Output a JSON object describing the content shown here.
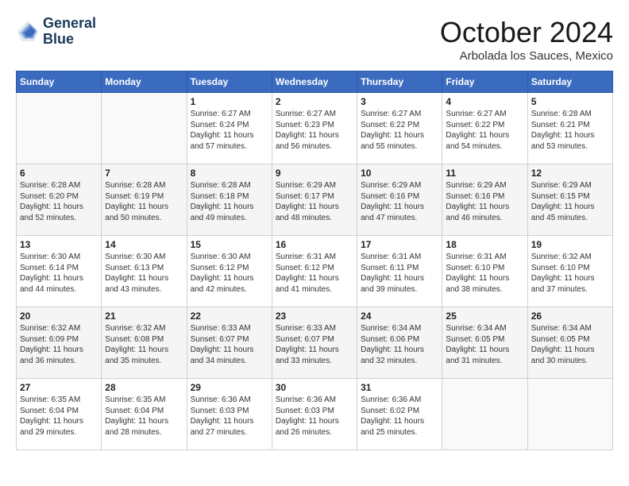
{
  "header": {
    "logo_line1": "General",
    "logo_line2": "Blue",
    "month_title": "October 2024",
    "location": "Arbolada los Sauces, Mexico"
  },
  "days_of_week": [
    "Sunday",
    "Monday",
    "Tuesday",
    "Wednesday",
    "Thursday",
    "Friday",
    "Saturday"
  ],
  "weeks": [
    [
      {
        "day": "",
        "sunrise": "",
        "sunset": "",
        "daylight": ""
      },
      {
        "day": "",
        "sunrise": "",
        "sunset": "",
        "daylight": ""
      },
      {
        "day": "1",
        "sunrise": "Sunrise: 6:27 AM",
        "sunset": "Sunset: 6:24 PM",
        "daylight": "Daylight: 11 hours and 57 minutes."
      },
      {
        "day": "2",
        "sunrise": "Sunrise: 6:27 AM",
        "sunset": "Sunset: 6:23 PM",
        "daylight": "Daylight: 11 hours and 56 minutes."
      },
      {
        "day": "3",
        "sunrise": "Sunrise: 6:27 AM",
        "sunset": "Sunset: 6:22 PM",
        "daylight": "Daylight: 11 hours and 55 minutes."
      },
      {
        "day": "4",
        "sunrise": "Sunrise: 6:27 AM",
        "sunset": "Sunset: 6:22 PM",
        "daylight": "Daylight: 11 hours and 54 minutes."
      },
      {
        "day": "5",
        "sunrise": "Sunrise: 6:28 AM",
        "sunset": "Sunset: 6:21 PM",
        "daylight": "Daylight: 11 hours and 53 minutes."
      }
    ],
    [
      {
        "day": "6",
        "sunrise": "Sunrise: 6:28 AM",
        "sunset": "Sunset: 6:20 PM",
        "daylight": "Daylight: 11 hours and 52 minutes."
      },
      {
        "day": "7",
        "sunrise": "Sunrise: 6:28 AM",
        "sunset": "Sunset: 6:19 PM",
        "daylight": "Daylight: 11 hours and 50 minutes."
      },
      {
        "day": "8",
        "sunrise": "Sunrise: 6:28 AM",
        "sunset": "Sunset: 6:18 PM",
        "daylight": "Daylight: 11 hours and 49 minutes."
      },
      {
        "day": "9",
        "sunrise": "Sunrise: 6:29 AM",
        "sunset": "Sunset: 6:17 PM",
        "daylight": "Daylight: 11 hours and 48 minutes."
      },
      {
        "day": "10",
        "sunrise": "Sunrise: 6:29 AM",
        "sunset": "Sunset: 6:16 PM",
        "daylight": "Daylight: 11 hours and 47 minutes."
      },
      {
        "day": "11",
        "sunrise": "Sunrise: 6:29 AM",
        "sunset": "Sunset: 6:16 PM",
        "daylight": "Daylight: 11 hours and 46 minutes."
      },
      {
        "day": "12",
        "sunrise": "Sunrise: 6:29 AM",
        "sunset": "Sunset: 6:15 PM",
        "daylight": "Daylight: 11 hours and 45 minutes."
      }
    ],
    [
      {
        "day": "13",
        "sunrise": "Sunrise: 6:30 AM",
        "sunset": "Sunset: 6:14 PM",
        "daylight": "Daylight: 11 hours and 44 minutes."
      },
      {
        "day": "14",
        "sunrise": "Sunrise: 6:30 AM",
        "sunset": "Sunset: 6:13 PM",
        "daylight": "Daylight: 11 hours and 43 minutes."
      },
      {
        "day": "15",
        "sunrise": "Sunrise: 6:30 AM",
        "sunset": "Sunset: 6:12 PM",
        "daylight": "Daylight: 11 hours and 42 minutes."
      },
      {
        "day": "16",
        "sunrise": "Sunrise: 6:31 AM",
        "sunset": "Sunset: 6:12 PM",
        "daylight": "Daylight: 11 hours and 41 minutes."
      },
      {
        "day": "17",
        "sunrise": "Sunrise: 6:31 AM",
        "sunset": "Sunset: 6:11 PM",
        "daylight": "Daylight: 11 hours and 39 minutes."
      },
      {
        "day": "18",
        "sunrise": "Sunrise: 6:31 AM",
        "sunset": "Sunset: 6:10 PM",
        "daylight": "Daylight: 11 hours and 38 minutes."
      },
      {
        "day": "19",
        "sunrise": "Sunrise: 6:32 AM",
        "sunset": "Sunset: 6:10 PM",
        "daylight": "Daylight: 11 hours and 37 minutes."
      }
    ],
    [
      {
        "day": "20",
        "sunrise": "Sunrise: 6:32 AM",
        "sunset": "Sunset: 6:09 PM",
        "daylight": "Daylight: 11 hours and 36 minutes."
      },
      {
        "day": "21",
        "sunrise": "Sunrise: 6:32 AM",
        "sunset": "Sunset: 6:08 PM",
        "daylight": "Daylight: 11 hours and 35 minutes."
      },
      {
        "day": "22",
        "sunrise": "Sunrise: 6:33 AM",
        "sunset": "Sunset: 6:07 PM",
        "daylight": "Daylight: 11 hours and 34 minutes."
      },
      {
        "day": "23",
        "sunrise": "Sunrise: 6:33 AM",
        "sunset": "Sunset: 6:07 PM",
        "daylight": "Daylight: 11 hours and 33 minutes."
      },
      {
        "day": "24",
        "sunrise": "Sunrise: 6:34 AM",
        "sunset": "Sunset: 6:06 PM",
        "daylight": "Daylight: 11 hours and 32 minutes."
      },
      {
        "day": "25",
        "sunrise": "Sunrise: 6:34 AM",
        "sunset": "Sunset: 6:05 PM",
        "daylight": "Daylight: 11 hours and 31 minutes."
      },
      {
        "day": "26",
        "sunrise": "Sunrise: 6:34 AM",
        "sunset": "Sunset: 6:05 PM",
        "daylight": "Daylight: 11 hours and 30 minutes."
      }
    ],
    [
      {
        "day": "27",
        "sunrise": "Sunrise: 6:35 AM",
        "sunset": "Sunset: 6:04 PM",
        "daylight": "Daylight: 11 hours and 29 minutes."
      },
      {
        "day": "28",
        "sunrise": "Sunrise: 6:35 AM",
        "sunset": "Sunset: 6:04 PM",
        "daylight": "Daylight: 11 hours and 28 minutes."
      },
      {
        "day": "29",
        "sunrise": "Sunrise: 6:36 AM",
        "sunset": "Sunset: 6:03 PM",
        "daylight": "Daylight: 11 hours and 27 minutes."
      },
      {
        "day": "30",
        "sunrise": "Sunrise: 6:36 AM",
        "sunset": "Sunset: 6:03 PM",
        "daylight": "Daylight: 11 hours and 26 minutes."
      },
      {
        "day": "31",
        "sunrise": "Sunrise: 6:36 AM",
        "sunset": "Sunset: 6:02 PM",
        "daylight": "Daylight: 11 hours and 25 minutes."
      },
      {
        "day": "",
        "sunrise": "",
        "sunset": "",
        "daylight": ""
      },
      {
        "day": "",
        "sunrise": "",
        "sunset": "",
        "daylight": ""
      }
    ]
  ]
}
